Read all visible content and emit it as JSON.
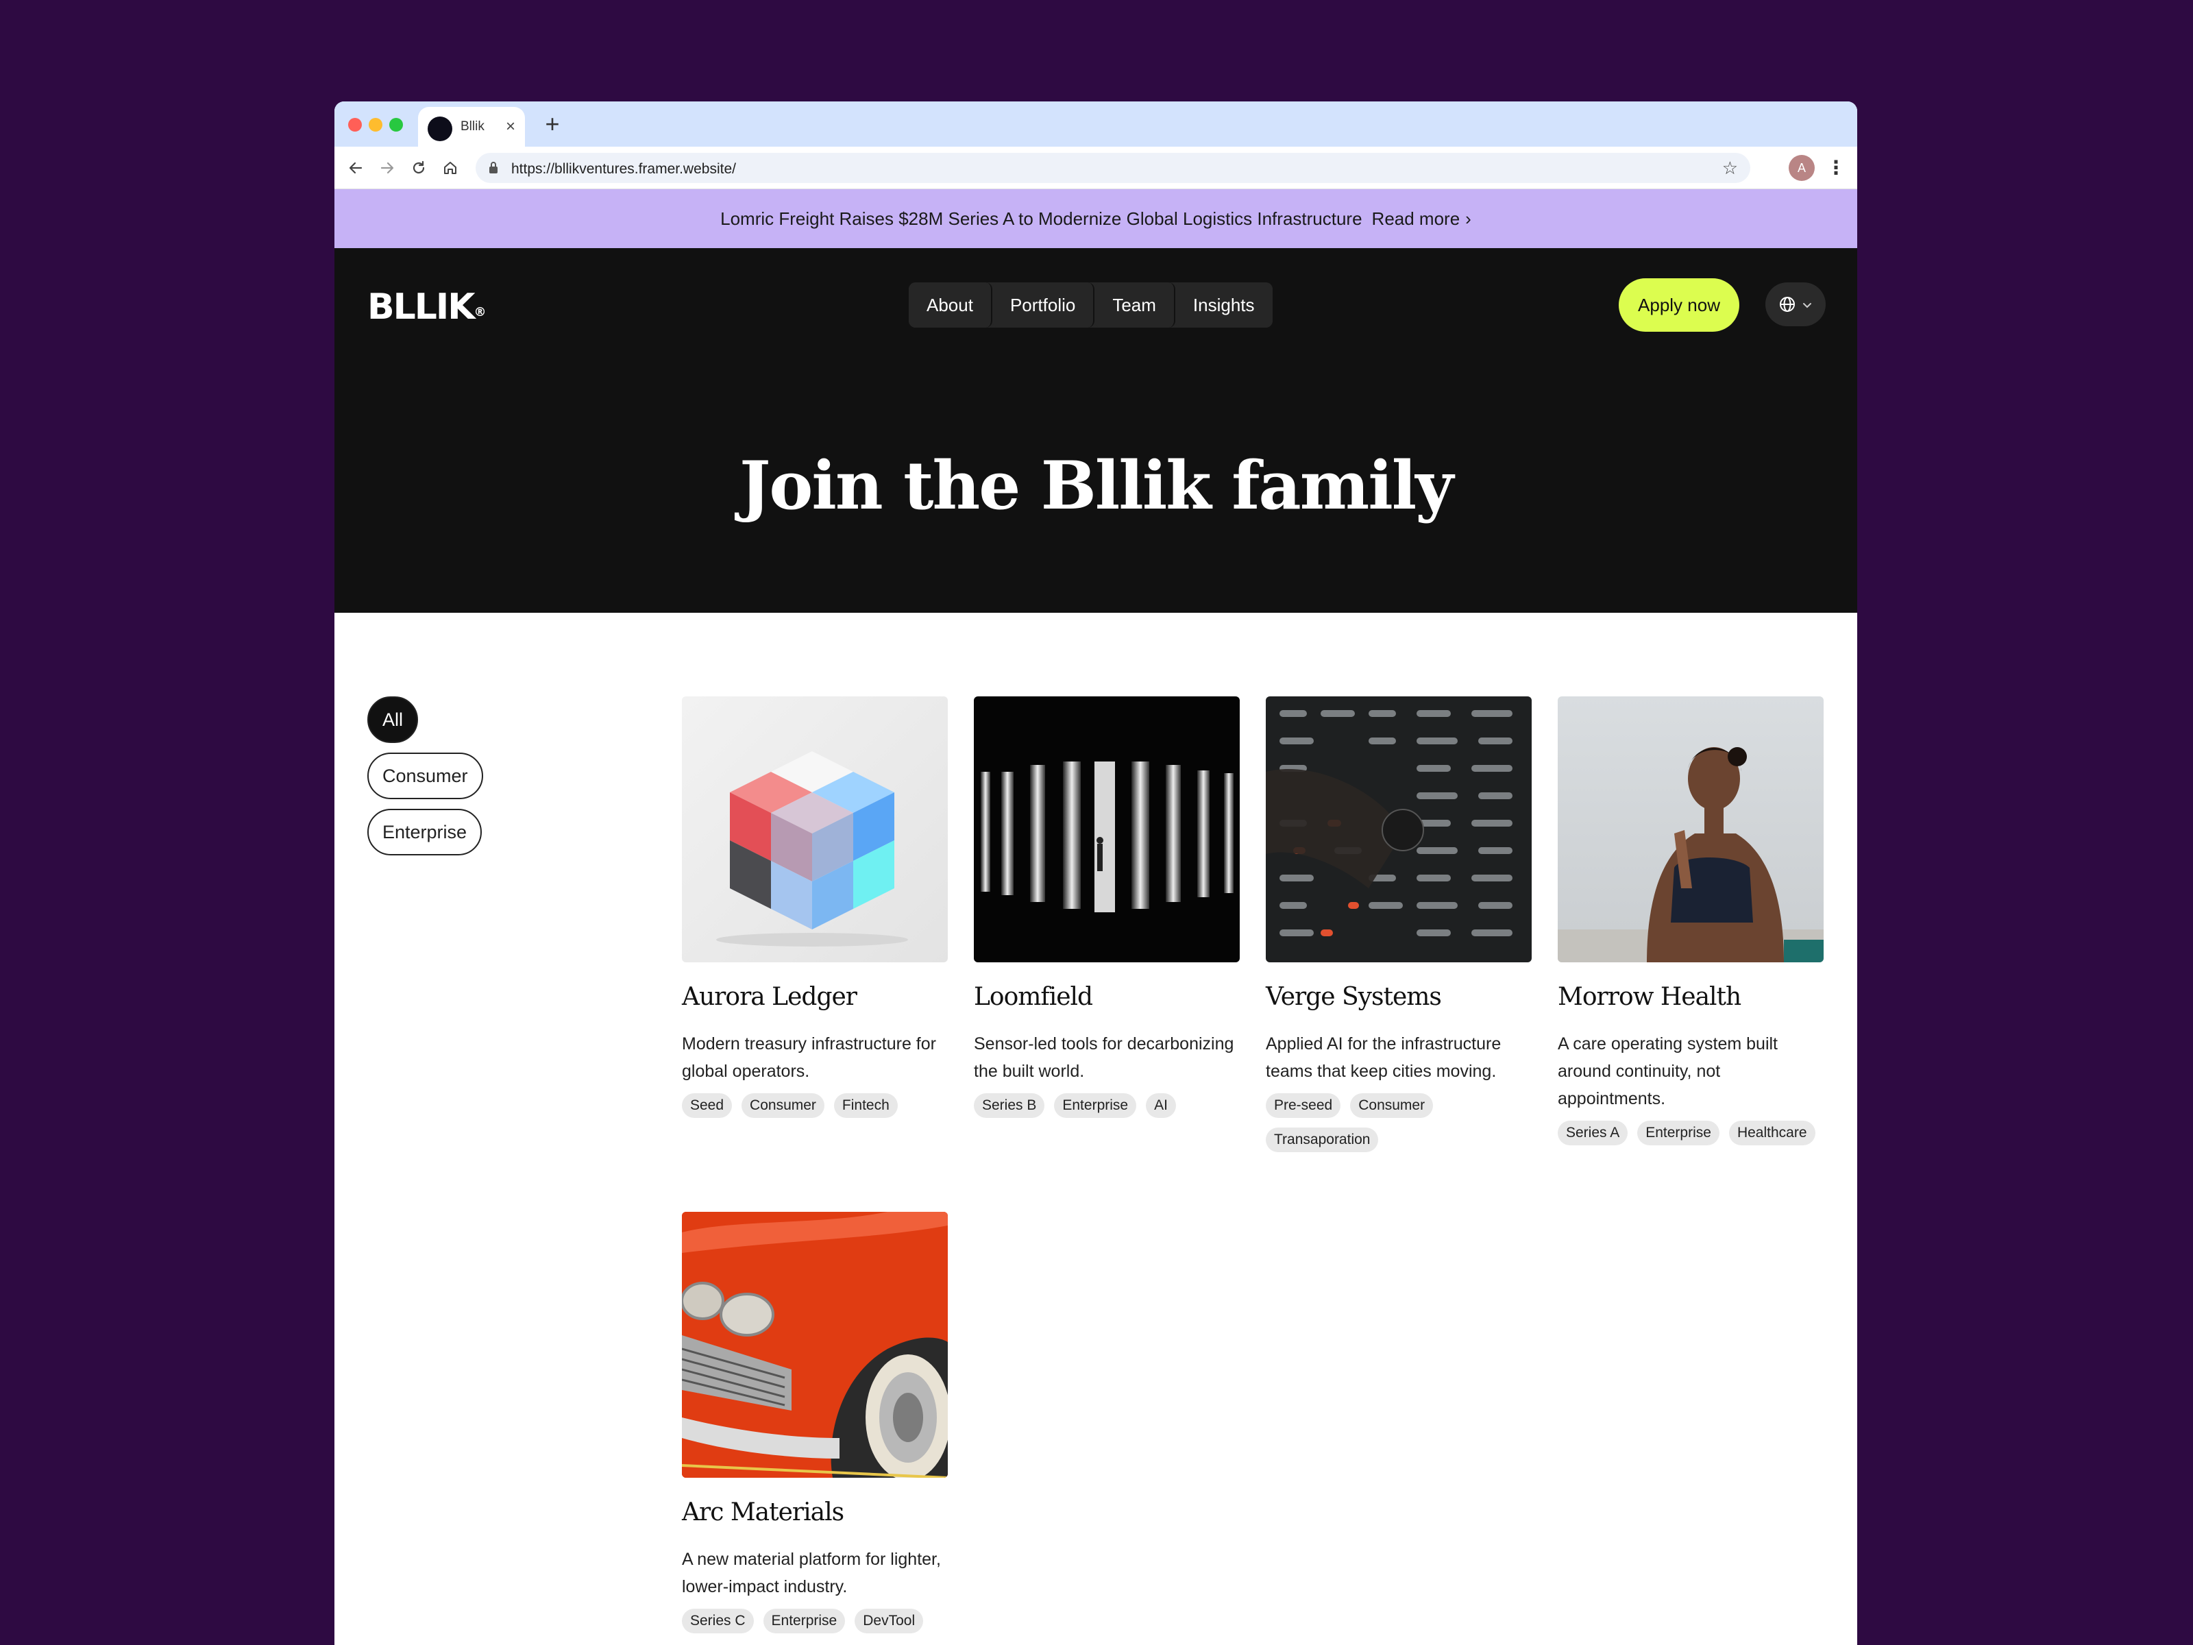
{
  "browser": {
    "tab_title": "Bllik",
    "tab_close": "×",
    "new_tab": "+",
    "url": "https://bllikventures.framer.website/",
    "profile_initial": "A"
  },
  "announcement": {
    "text": "Lomric Freight Raises $28M Series A to Modernize Global Logistics Infrastructure",
    "link": "Read more",
    "chevron": "›"
  },
  "header": {
    "logo": "BLLIK",
    "logo_mark": "®",
    "nav": [
      "About",
      "Portfolio",
      "Team",
      "Insights"
    ],
    "cta": "Apply now",
    "lang_chevron": "⌄",
    "accent_color": "#dcfd4f"
  },
  "hero": {
    "title": "Join the Bllik family"
  },
  "filters": [
    "All",
    "Consumer",
    "Enterprise"
  ],
  "portfolio": [
    {
      "name": "Aurora Ledger",
      "description": "Modern treasury infrastructure for global operators.",
      "tags": [
        "Seed",
        "Consumer",
        "Fintech"
      ],
      "image": "glass-cube-image"
    },
    {
      "name": "Loomfield",
      "description": "Sensor-led tools for decarbonizing the built world.",
      "tags": [
        "Series B",
        "Enterprise",
        "AI"
      ],
      "image": "light-columns-image"
    },
    {
      "name": "Verge Systems",
      "description": "Applied AI for the infrastructure teams that keep cities moving.",
      "tags": [
        "Pre-seed",
        "Consumer",
        "Transaporation"
      ],
      "image": "led-board-image"
    },
    {
      "name": "Morrow Health",
      "description": "A care operating system built around continuity, not appointments.",
      "tags": [
        "Series A",
        "Enterprise",
        "Healthcare"
      ],
      "image": "meditating-woman-image"
    },
    {
      "name": "Arc Materials",
      "description": "A new material platform for lighter, lower-impact industry.",
      "tags": [
        "Series C",
        "Enterprise",
        "DevTool"
      ],
      "image": "red-car-image"
    }
  ]
}
